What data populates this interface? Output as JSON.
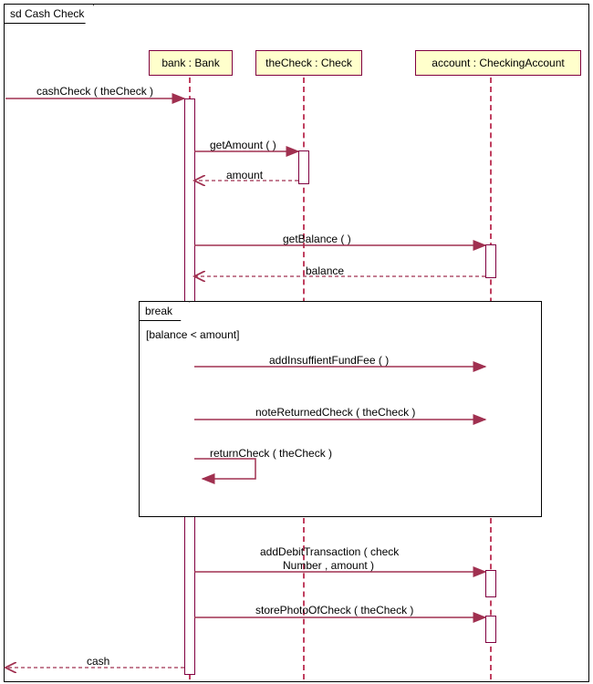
{
  "diagram": {
    "title": "sd Cash Check",
    "lifelines": {
      "bank": "bank : Bank",
      "check": "theCheck : Check",
      "account": "account : CheckingAccount"
    },
    "fragment": {
      "operator": "break",
      "guard": "[balance < amount]"
    },
    "messages": {
      "m1": "cashCheck ( theCheck )",
      "m2": "getAmount (  )",
      "m2r": "amount",
      "m3": "getBalance (  )",
      "m3r": "balance",
      "m4": "addInsuffientFundFee (  )",
      "m5": "noteReturnedCheck ( theCheck )",
      "m6": "returnCheck ( theCheck )",
      "m7a": "addDebitTransaction ( check",
      "m7b": "Number , amount )",
      "m8": "storePhotoOfCheck ( theCheck )",
      "m9": "cash"
    }
  },
  "chart_data": {
    "type": "uml-sequence-diagram",
    "name": "Cash Check",
    "lifelines": [
      {
        "id": "actor",
        "name": "",
        "type": "external"
      },
      {
        "id": "bank",
        "name": "bank",
        "type": "Bank"
      },
      {
        "id": "theCheck",
        "name": "theCheck",
        "type": "Check"
      },
      {
        "id": "account",
        "name": "account",
        "type": "CheckingAccount"
      }
    ],
    "messages": [
      {
        "from": "actor",
        "to": "bank",
        "label": "cashCheck(theCheck)",
        "kind": "sync"
      },
      {
        "from": "bank",
        "to": "theCheck",
        "label": "getAmount()",
        "kind": "sync"
      },
      {
        "from": "theCheck",
        "to": "bank",
        "label": "amount",
        "kind": "return"
      },
      {
        "from": "bank",
        "to": "account",
        "label": "getBalance()",
        "kind": "sync"
      },
      {
        "from": "account",
        "to": "bank",
        "label": "balance",
        "kind": "return"
      },
      {
        "fragment": "break",
        "guard": "balance < amount",
        "messages": [
          {
            "from": "bank",
            "to": "account",
            "label": "addInsuffientFundFee()",
            "kind": "sync"
          },
          {
            "from": "bank",
            "to": "account",
            "label": "noteReturnedCheck(theCheck)",
            "kind": "sync"
          },
          {
            "from": "bank",
            "to": "bank",
            "label": "returnCheck(theCheck)",
            "kind": "self"
          }
        ]
      },
      {
        "from": "bank",
        "to": "account",
        "label": "addDebitTransaction(checkNumber, amount)",
        "kind": "sync"
      },
      {
        "from": "bank",
        "to": "account",
        "label": "storePhotoOfCheck(theCheck)",
        "kind": "sync"
      },
      {
        "from": "bank",
        "to": "actor",
        "label": "cash",
        "kind": "return"
      }
    ]
  }
}
